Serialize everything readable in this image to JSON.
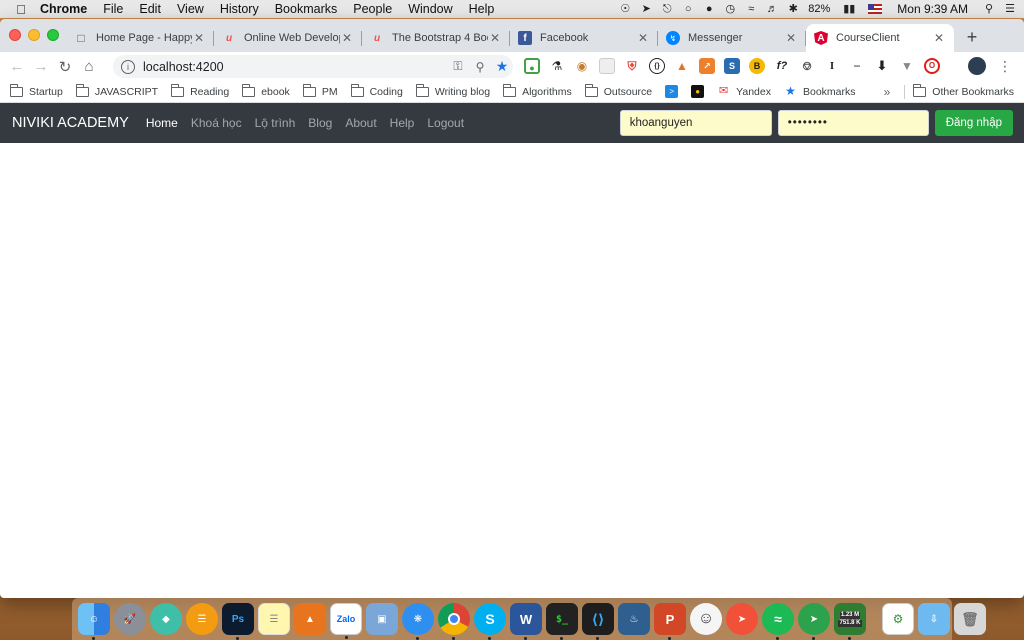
{
  "menubar": {
    "app_name": "Chrome",
    "items": [
      "File",
      "Edit",
      "View",
      "History",
      "Bookmarks",
      "People",
      "Window",
      "Help"
    ],
    "battery": "82%",
    "clock": "Mon 9:39 AM"
  },
  "tabs": [
    {
      "title": "Home Page - Happy",
      "favicon": "document-icon"
    },
    {
      "title": "Online Web Develop",
      "favicon": "udemy-icon"
    },
    {
      "title": "The Bootstrap 4 Boo",
      "favicon": "udemy-icon"
    },
    {
      "title": "Facebook",
      "favicon": "facebook-icon"
    },
    {
      "title": "Messenger",
      "favicon": "messenger-icon"
    },
    {
      "title": "CourseClient",
      "favicon": "angular-icon",
      "active": true
    }
  ],
  "address_bar": {
    "url": "localhost:4200"
  },
  "bookmarks": [
    "Startup",
    "JAVASCRIPT",
    "Reading",
    "ebook",
    "PM",
    "Coding",
    "Writing blog",
    "Algorithms",
    "Outsource",
    "Yandex",
    "Bookmarks"
  ],
  "other_bookmarks": "Other Bookmarks",
  "site": {
    "brand": "NIVIKI ACADEMY",
    "nav": [
      "Home",
      "Khoá học",
      "Lộ trình",
      "Blog",
      "About",
      "Help",
      "Logout"
    ],
    "username_value": "khoanguyen",
    "password_value": "••••••••",
    "login_label": "Đăng nhập"
  },
  "dock": {
    "torrent_up": "1.23 M",
    "torrent_down": "751.8 K"
  },
  "colors": {
    "navbar_bg": "#343a40",
    "success": "#28a745",
    "autofill": "#fdfbc9"
  }
}
